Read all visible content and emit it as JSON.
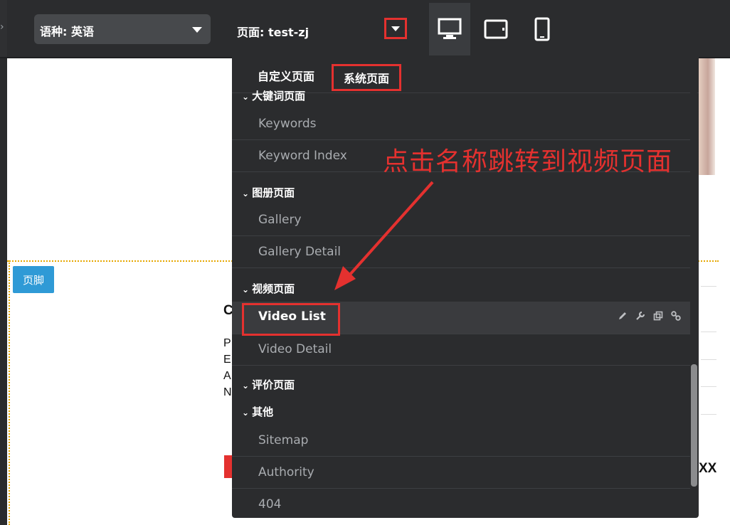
{
  "toolbar": {
    "language_select": {
      "value": "语种: 英语"
    },
    "page_select": {
      "value": "页面: test-zj"
    },
    "devices": [
      {
        "name": "desktop",
        "active": true
      },
      {
        "name": "tablet",
        "active": false
      },
      {
        "name": "mobile",
        "active": false
      }
    ]
  },
  "canvas": {
    "footer_badge": "页脚",
    "partial_letters": [
      "C",
      "P",
      "E",
      "A",
      "N"
    ],
    "partial_right": "XX"
  },
  "dropdown": {
    "tabs": [
      "自定义页面",
      "系统页面"
    ],
    "active_tab": "系统页面",
    "groups": {
      "keyword": "大键词页面",
      "gallery": "图册页面",
      "video": "视频页面",
      "review": "评价页面",
      "other": "其他"
    },
    "items": {
      "keywords": "Keywords",
      "keyword_index": "Keyword Index",
      "gallery": "Gallery",
      "gallery_detail": "Gallery Detail",
      "video_list": "Video List",
      "video_detail": "Video Detail",
      "sitemap": "Sitemap",
      "authority": "Authority",
      "not_found": "404"
    },
    "item_tools": [
      "edit-icon",
      "wrench-icon",
      "copy-icon",
      "link-icon"
    ]
  },
  "annotation": {
    "text": "点击名称跳转到视频页面",
    "color": "#e4312f"
  },
  "colors": {
    "toolbar_bg": "#2b2c2e",
    "highlight_red": "#e4312f",
    "footer_badge_blue": "#2f9ad6",
    "guide_dotted": "#e6a700"
  }
}
